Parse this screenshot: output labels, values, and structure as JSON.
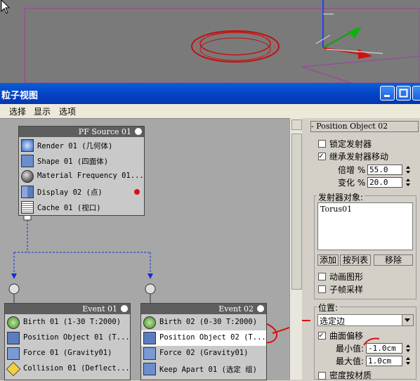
{
  "window": {
    "title": "粒子视图"
  },
  "menu": {
    "items": [
      "选择",
      "显示",
      "选项"
    ]
  },
  "nodes": {
    "source": {
      "title": "PF Source 01",
      "ops": [
        "Render 01 (几何体)",
        "Shape 01 (四面体)",
        "Material Frequency 01...",
        "Display 02 (点)",
        "Cache 01 (视口)"
      ]
    },
    "event1": {
      "title": "Event 01",
      "ops": [
        "Birth 01 (1-30 T:2000)",
        "Position Object 01 (T...",
        "Force 01 (Gravity01)",
        "Collision 01 (Deflect..."
      ]
    },
    "event2": {
      "title": "Event 02",
      "ops": [
        "Birth 02 (0-30 T:2000)",
        "Position Object 02 (T...",
        "Force 02 (Gravity01)",
        "Keep Apart 01 (选定 组)"
      ]
    }
  },
  "panel": {
    "rollout_title": "-  Position Object 02",
    "lock_emitter": "锁定发射器",
    "inherit_motion": "继承发射器移动",
    "multiplier": {
      "label": "倍增 %",
      "value": "55.0"
    },
    "variation": {
      "label": "变化 %",
      "value": "20.0"
    },
    "emitter_objects": "发射器对象:",
    "list_items": [
      "Torus01"
    ],
    "buttons": {
      "add": "添加",
      "by_list": "按列表",
      "remove": "移除"
    },
    "animated_shape": "动画图形",
    "subframe": "子帧采样",
    "location": {
      "label": "位置:",
      "value": "选定边"
    },
    "surface_offset": "曲面偏移",
    "min": {
      "label": "最小值:",
      "value": "-1.0cm"
    },
    "max": {
      "label": "最大值:",
      "value": "1.0cm"
    },
    "density_by_material": "密度按材质"
  },
  "colors": {
    "accent_red": "#d81010",
    "title_blue": "#0546c8",
    "node_header": "#5e5e5e"
  }
}
